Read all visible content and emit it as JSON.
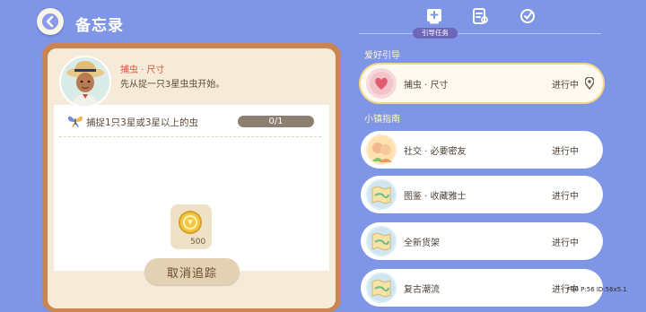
{
  "header": {
    "title": "备忘录"
  },
  "tabs": {
    "active_label": "引导任务"
  },
  "task": {
    "name": "捕虫 · 尺寸",
    "description": "先从捉一只3星虫虫开始。",
    "goal": "捕捉1只3星或3星以上的虫",
    "progress": "0/1",
    "progress_fraction": 0.0,
    "reward_count": "500",
    "cancel_label": "取消追踪"
  },
  "sections": {
    "guide_label": "爱好引导",
    "town_label": "小镇指南"
  },
  "items": [
    {
      "label": "捕虫 · 尺寸",
      "status": "进行中",
      "selected": true,
      "icon": "heart-icon"
    },
    {
      "label": "社交 · 必要密友",
      "status": "进行中",
      "icon": "friends-icon"
    },
    {
      "label": "图鉴 · 收藏雅士",
      "status": "进行中",
      "icon": "map-icon"
    },
    {
      "label": "全新货架",
      "status": "进行中",
      "icon": "map-icon"
    },
    {
      "label": "复古潮流",
      "status": "进行中",
      "icon": "map-icon"
    }
  ],
  "overlay_text": "F30 P:56 ID:56x5.1",
  "colors": {
    "background": "#7f95e6",
    "accent_red": "#d2573b",
    "card": "#f5ebd8"
  }
}
